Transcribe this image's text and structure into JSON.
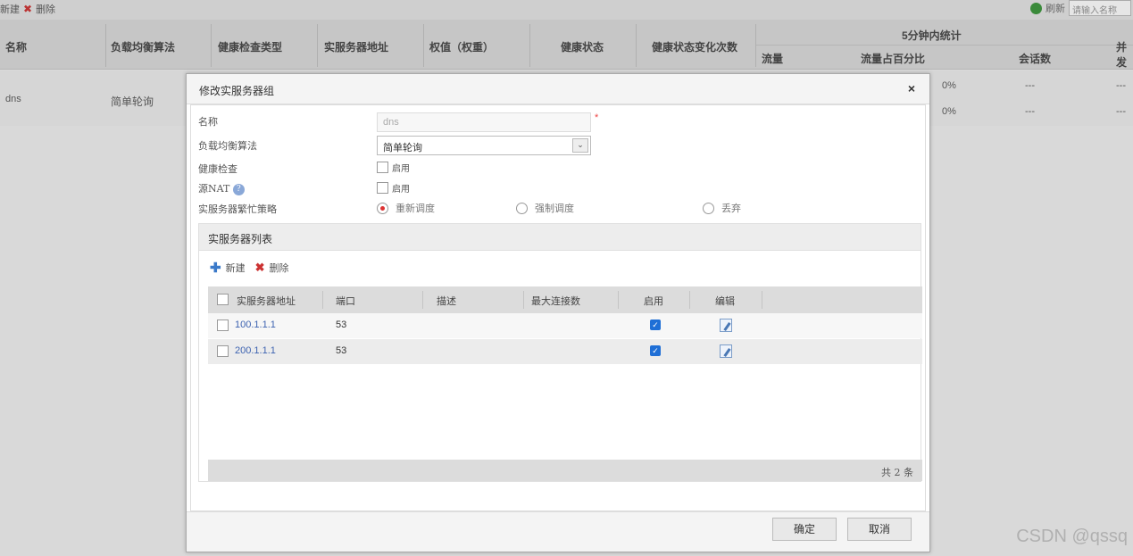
{
  "toolbar": {
    "new_label": "新建",
    "delete_label": "删除",
    "refresh_label": "刷新",
    "search_placeholder": "请输入名称"
  },
  "bg_table": {
    "headers": {
      "name": "名称",
      "algorithm": "负载均衡算法",
      "health_type": "健康检查类型",
      "server_addr": "实服务器地址",
      "weight": "权值（权重）",
      "health_status": "健康状态",
      "health_changes": "健康状态变化次数",
      "stats_5min": "5分钟内统计",
      "traffic": "流量",
      "traffic_pct": "流量占百分比",
      "sessions": "会话数",
      "concurrent": "并发"
    },
    "row": {
      "name": "dns",
      "algorithm": "简单轮询",
      "pct1": "0%",
      "pct2": "0%",
      "dash": "---"
    }
  },
  "modal": {
    "title": "修改实服务器组",
    "close": "×",
    "form": {
      "name_label": "名称",
      "name_value": "dns",
      "required_mark": "*",
      "algorithm_label": "负载均衡算法",
      "algorithm_value": "简单轮询",
      "select_arrow": "⌄",
      "health_label": "健康检查",
      "health_option": "启用",
      "snat_label": "源NAT",
      "snat_help": "?",
      "snat_option": "启用",
      "busy_label": "实服务器繁忙策略",
      "busy_options": [
        "重新调度",
        "强制调度",
        "丢弃"
      ],
      "busy_selected": "重新调度"
    },
    "panel": {
      "title": "实服务器列表",
      "new_label": "新建",
      "delete_label": "删除",
      "columns": {
        "addr": "实服务器地址",
        "port": "端口",
        "desc": "描述",
        "maxconn": "最大连接数",
        "enabled": "启用",
        "edit": "编辑"
      },
      "rows": [
        {
          "addr": "100.1.1.1",
          "port": "53",
          "desc": "",
          "maxconn": "",
          "enabled": true
        },
        {
          "addr": "200.1.1.1",
          "port": "53",
          "desc": "",
          "maxconn": "",
          "enabled": true
        }
      ],
      "footer": "共 2 条"
    },
    "buttons": {
      "ok": "确定",
      "cancel": "取消"
    }
  },
  "watermark": "CSDN @qssq"
}
